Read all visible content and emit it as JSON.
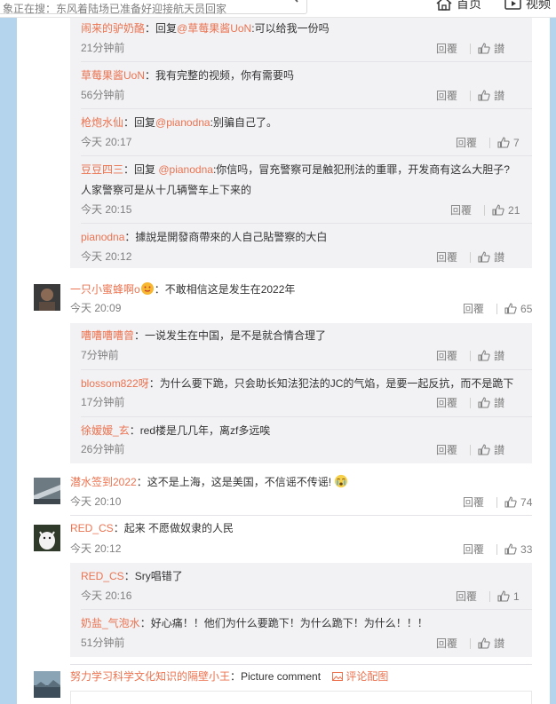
{
  "topbar": {
    "search_placeholder": "象正在搜：东风着陆场已准备好迎接航天员回家",
    "home_label": "首页",
    "video_label": "视频"
  },
  "actions": {
    "reply_label": "回覆",
    "like_label": "讃"
  },
  "comments": [
    {
      "kind": "reply",
      "user": "闹来的驴奶酪",
      "text_pre": "：回复",
      "mention": "@草莓果酱UoN",
      "text_post": ":可以给我一份吗",
      "time": "21分钟前",
      "likes": ""
    },
    {
      "kind": "reply",
      "user": "草莓果酱UoN",
      "text_pre": "：我有完整的视频，你有需要吗",
      "mention": "",
      "text_post": "",
      "time": "56分钟前",
      "likes": ""
    },
    {
      "kind": "reply",
      "user": "枪炮水仙",
      "text_pre": "：回复",
      "mention": "@pianodna",
      "text_post": ":别骗自己了。",
      "time": "今天 20:17",
      "likes": "7"
    },
    {
      "kind": "reply",
      "user": "豆豆四三",
      "text_pre": "：回复 ",
      "mention": "@pianodna",
      "text_post": ":你信吗，冒充警察可是触犯刑法的重罪，开发商有这么大胆子?",
      "text_line2": "人家警察可是从十几辆警车上下来的",
      "time": "今天 20:15",
      "likes": "21"
    },
    {
      "kind": "reply",
      "user": "pianodna",
      "text_pre": "：據說是開發商帶來的人自己貼警察的大白",
      "mention": "",
      "text_post": "",
      "time": "今天 20:12",
      "likes": ""
    },
    {
      "kind": "main",
      "user": "一只小蜜蜂啊o",
      "text_pre": "：不敢相信这是发生在2022年",
      "time": "今天 20:09",
      "likes": "65"
    },
    {
      "kind": "reply",
      "user": "嘈嘈嘈嘈曾",
      "text_pre": "：一说发生在中国，是不是就合情合理了",
      "time": "7分钟前",
      "likes": ""
    },
    {
      "kind": "reply",
      "user": "blossom822呀",
      "text_pre": "：为什么要下跪，只会助长知法犯法的JC的气焰，是要一起反抗，而不是跪下",
      "time": "17分钟前",
      "likes": ""
    },
    {
      "kind": "reply",
      "user": "徐嫒嫒_玄",
      "text_pre": "：red楼是几几年，离zf多远唉",
      "time": "26分钟前",
      "likes": ""
    },
    {
      "kind": "main",
      "user": "潜水签到2022",
      "text_pre": "：这不是上海，这是美国，不信谣不传谣!",
      "time": "今天 20:10",
      "likes": "74"
    },
    {
      "kind": "main",
      "user": "RED_CS",
      "text_pre": "：起来 不愿做奴隶的人民",
      "time": "今天 20:12",
      "likes": "33"
    },
    {
      "kind": "reply",
      "user": "RED_CS",
      "text_pre": "：Sry唱错了",
      "time": "今天 20:16",
      "likes": "1"
    },
    {
      "kind": "reply",
      "user": "奶盐_气泡水",
      "text_pre": "：好心痛！！他们为什么要跪下！为什么跪下！为什么！！！",
      "time": "51分钟前",
      "likes": ""
    },
    {
      "kind": "main",
      "user": "努力学习科学文化知识的隔壁小王",
      "text_pre": "：Picture comment",
      "pic_link": "评论配图",
      "time": "",
      "likes": ""
    }
  ],
  "colors": {
    "accent": "#eb7350",
    "page_bg": "#b4d3ec",
    "reply_bg": "#f2f2f5",
    "muted": "#808080"
  }
}
